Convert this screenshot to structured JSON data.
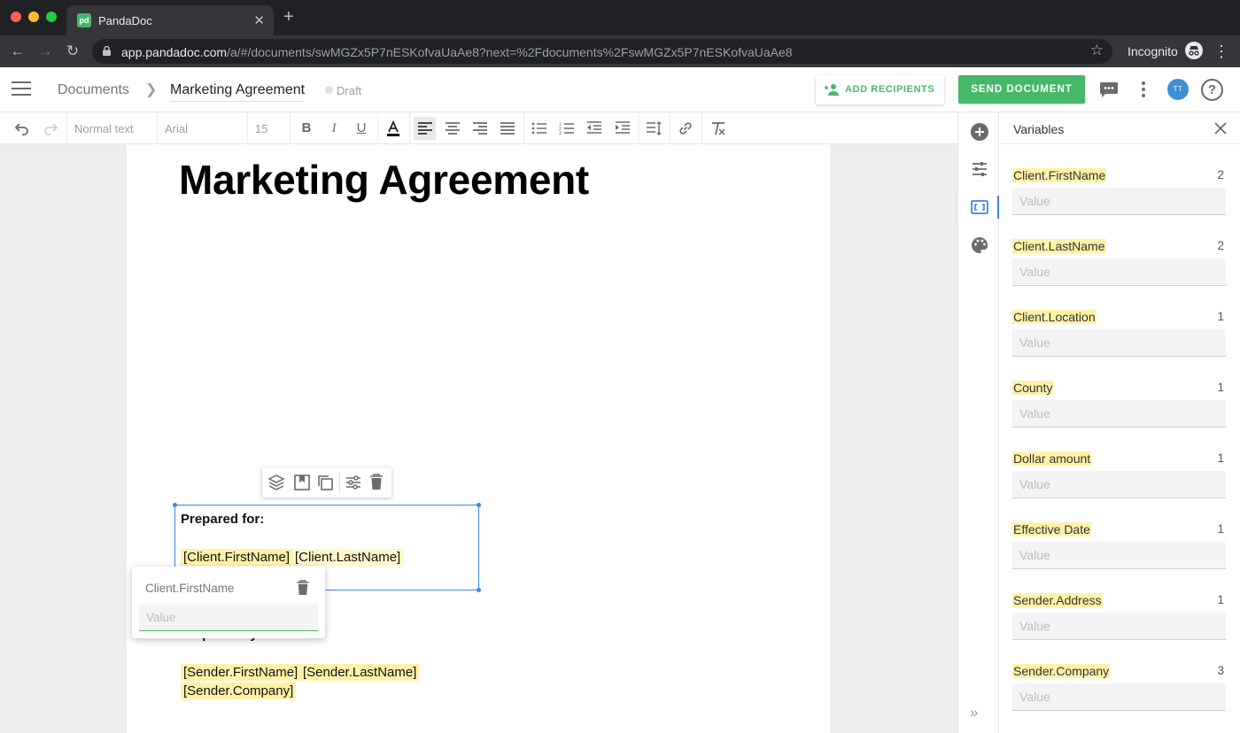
{
  "browser": {
    "tab_title": "PandaDoc",
    "url_host": "app.pandadoc.com",
    "url_path": "/a/#/documents/swMGZx5P7nESKofvaUaAe8?next=%2Fdocuments%2FswMGZx5P7nESKofvaUaAe8",
    "profile_label": "Incognito",
    "colors": {
      "close": "#ff5f57",
      "minimize": "#febc2e",
      "zoom": "#28c840"
    }
  },
  "header": {
    "breadcrumb_root": "Documents",
    "document_title": "Marketing Agreement",
    "status": "Draft",
    "add_recipients_label": "ADD RECIPIENTS",
    "send_label": "SEND DOCUMENT",
    "avatar_initials": "TT",
    "help_glyph": "?"
  },
  "toolbar": {
    "style_value": "Normal text",
    "font_value": "Arial",
    "size_value": "15"
  },
  "document": {
    "title": "Marketing Agreement",
    "prepared_for_label": "Prepared for:",
    "prepared_by_label": "Prepared by:",
    "client_vars": [
      "[Client.FirstName]",
      "[Client.LastName]"
    ],
    "sender_vars": [
      "[Sender.FirstName]",
      "[Sender.LastName]",
      "[Sender.Company]"
    ]
  },
  "popover": {
    "variable_name": "Client.FirstName",
    "value_placeholder": "Value"
  },
  "panel": {
    "title": "Variables",
    "value_placeholder": "Value",
    "variables": [
      {
        "name": "Client.FirstName",
        "count": "2"
      },
      {
        "name": "Client.LastName",
        "count": "2"
      },
      {
        "name": "Client.Location",
        "count": "1"
      },
      {
        "name": "County",
        "count": "1"
      },
      {
        "name": "Dollar amount",
        "count": "1"
      },
      {
        "name": "Effective Date",
        "count": "1"
      },
      {
        "name": "Sender.Address",
        "count": "1"
      },
      {
        "name": "Sender.Company",
        "count": "3"
      }
    ]
  },
  "colors": {
    "brand_green": "#47b869",
    "selection_blue": "#3f84e5",
    "variable_highlight": "#fff2a8"
  }
}
